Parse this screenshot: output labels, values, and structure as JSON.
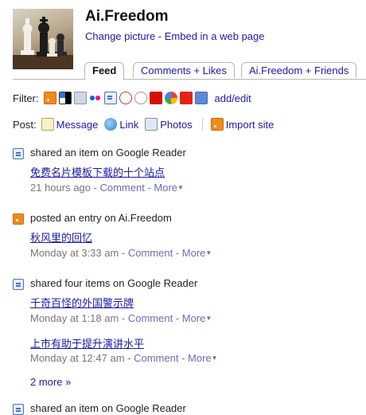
{
  "profile": {
    "name": "Ai.Freedom",
    "change_picture": "Change picture",
    "separator": " - ",
    "embed": "Embed in a web page"
  },
  "tabs": [
    {
      "label": "Feed",
      "active": true
    },
    {
      "label": "Comments + Likes",
      "active": false
    },
    {
      "label": "Ai.Freedom + Friends",
      "active": false
    }
  ],
  "filter": {
    "label": "Filter:",
    "services": [
      "rss-icon",
      "delicious-icon",
      "social-icon",
      "flickr-icon",
      "google-reader-icon",
      "speech-bubble-icon",
      "yelp-icon",
      "lastfm-icon",
      "picasa-icon",
      "youtube-icon",
      "friendfeed-icon"
    ],
    "add_edit": "add/edit"
  },
  "post": {
    "label": "Post:",
    "message": "Message",
    "link": "Link",
    "photos": "Photos",
    "import": "Import site"
  },
  "entries": [
    {
      "icon": "google-reader-icon",
      "head": "shared an item on Google Reader",
      "items": [
        {
          "title": "免费名片模板下载的十个站点",
          "time": "21 hours ago"
        }
      ]
    },
    {
      "icon": "rss-icon",
      "head": "posted an entry on Ai.Freedom",
      "items": [
        {
          "title": "秋风里的回忆",
          "time": "Monday at 3:33 am"
        }
      ]
    },
    {
      "icon": "google-reader-icon",
      "head": "shared four items on Google Reader",
      "items": [
        {
          "title": "千奇百怪的外国警示牌",
          "time": "Monday at 1:18 am"
        },
        {
          "title": "上市有助于提升演讲水平",
          "time": "Monday at 12:47 am"
        }
      ],
      "more": "2 more »"
    },
    {
      "icon": "google-reader-icon",
      "head": "shared an item on Google Reader",
      "items": []
    }
  ],
  "meta": {
    "sep": " - ",
    "comment": "Comment",
    "more": "More"
  }
}
